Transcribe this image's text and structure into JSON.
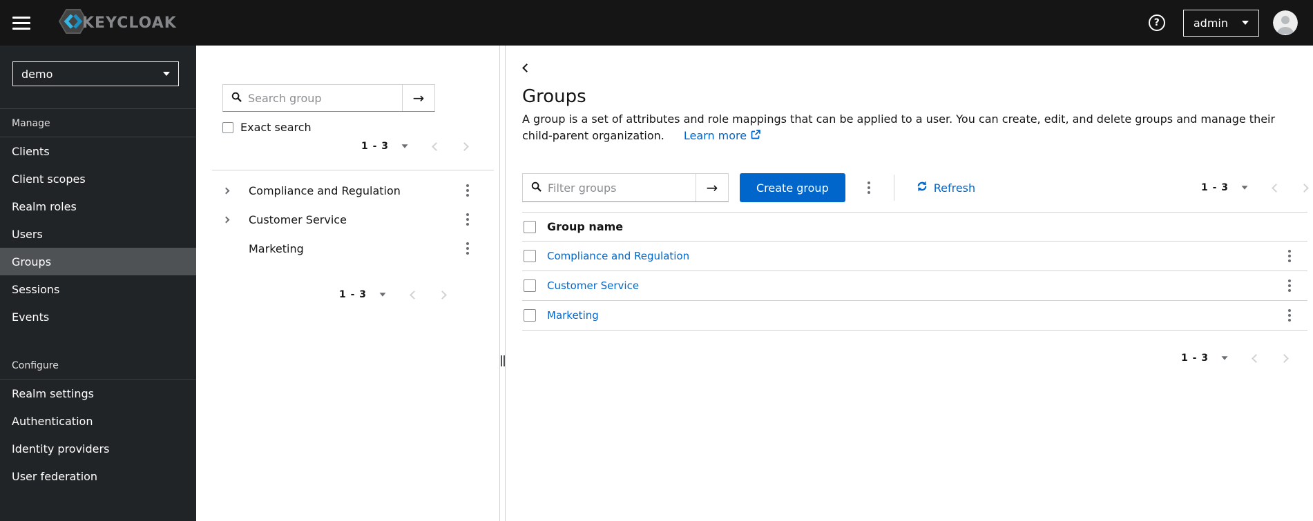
{
  "masthead": {
    "brand_text": "KEYCLOAK",
    "help_symbol": "?",
    "username": "admin"
  },
  "sidebar": {
    "realm": "demo",
    "manage_label": "Manage",
    "manage_items": [
      "Clients",
      "Client scopes",
      "Realm roles",
      "Users",
      "Groups",
      "Sessions",
      "Events"
    ],
    "active_item": "Groups",
    "configure_label": "Configure",
    "configure_items": [
      "Realm settings",
      "Authentication",
      "Identity providers",
      "User federation"
    ]
  },
  "tree": {
    "search_placeholder": "Search group",
    "arrow_symbol": "→",
    "exact_search_label": "Exact search",
    "pagination_top": "1 - 3",
    "pagination_bottom": "1 - 3",
    "items": [
      "Compliance and Regulation",
      "Customer Service",
      "Marketing"
    ]
  },
  "main": {
    "title": "Groups",
    "description": "A group is a set of attributes and role mappings that can be applied to a user. You can create, edit, and delete groups and manage their child-parent organization.",
    "learn_more_label": "Learn more",
    "toolbar": {
      "filter_placeholder": "Filter groups",
      "arrow_symbol": "→",
      "create_button_label": "Create group",
      "refresh_label": "Refresh",
      "pagination": "1 - 3"
    },
    "table": {
      "header": "Group name",
      "rows": [
        "Compliance and Regulation",
        "Customer Service",
        "Marketing"
      ]
    },
    "pagination_bottom": "1 - 3"
  },
  "colors": {
    "accent": "#0066cc",
    "link": "#0066cc",
    "masthead_bg": "#151515",
    "sidebar_bg": "#212427",
    "sidebar_active_bg": "#4f5255",
    "border": "#d2d2d2",
    "muted_text": "#6a6e73",
    "disabled_chevron": "#d2d2d2"
  }
}
